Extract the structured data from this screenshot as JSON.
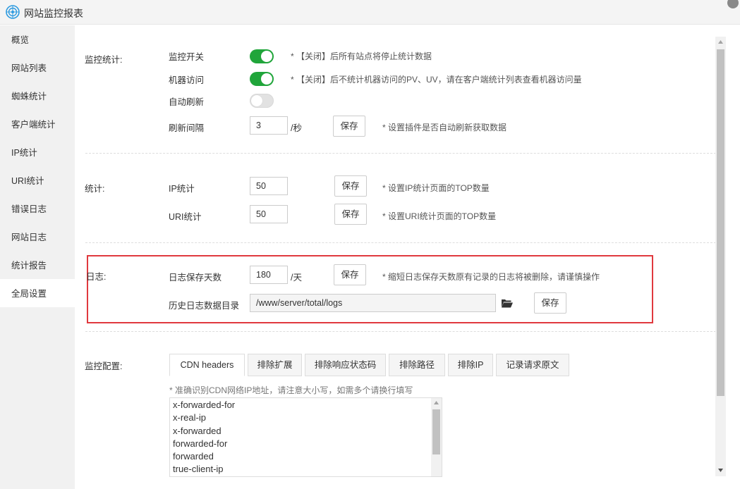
{
  "window": {
    "title": "网站监控报表"
  },
  "sidebar": {
    "items": [
      {
        "label": "概览"
      },
      {
        "label": "网站列表"
      },
      {
        "label": "蜘蛛统计"
      },
      {
        "label": "客户端统计"
      },
      {
        "label": "IP统计"
      },
      {
        "label": "URI统计"
      },
      {
        "label": "错误日志"
      },
      {
        "label": "网站日志"
      },
      {
        "label": "统计报告"
      },
      {
        "label": "全局设置"
      }
    ],
    "active_index": 9
  },
  "monitor": {
    "section_label": "监控统计:",
    "switch_label": "监控开关",
    "switch_on": true,
    "switch_hint": "* 【关闭】后所有站点将停止统计数据",
    "robot_label": "机器访问",
    "robot_on": true,
    "robot_hint": "* 【关闭】后不统计机器访问的PV、UV，请在客户端统计列表查看机器访问量",
    "autorefresh_label": "自动刷新",
    "autorefresh_on": false,
    "interval_label": "刷新间隔",
    "interval_value": "3",
    "interval_unit": "/秒",
    "save_label": "保存",
    "interval_hint": "* 设置插件是否自动刷新获取数据"
  },
  "stats": {
    "section_label": "统计:",
    "ip_label": "IP统计",
    "ip_value": "50",
    "ip_save": "保存",
    "ip_hint": "* 设置IP统计页面的TOP数量",
    "uri_label": "URI统计",
    "uri_value": "50",
    "uri_save": "保存",
    "uri_hint": "* 设置URI统计页面的TOP数量"
  },
  "logs": {
    "section_label": "日志:",
    "keep_label": "日志保存天数",
    "keep_value": "180",
    "keep_unit": "/天",
    "keep_save": "保存",
    "keep_hint": "* 缩短日志保存天数原有记录的日志将被删除，请谨慎操作",
    "dir_label": "历史日志数据目录",
    "dir_value": "/www/server/total/logs",
    "dir_save": "保存",
    "folder_icon": "folder-open-icon"
  },
  "config": {
    "section_label": "监控配置:",
    "tabs": [
      {
        "label": "CDN headers"
      },
      {
        "label": "排除扩展"
      },
      {
        "label": "排除响应状态码"
      },
      {
        "label": "排除路径"
      },
      {
        "label": "排除IP"
      },
      {
        "label": "记录请求原文"
      }
    ],
    "active_tab": 0,
    "cdn_hint": "* 准确识别CDN网络IP地址，请注意大小写，如需多个请换行填写",
    "cdn_headers": [
      "x-forwarded-for",
      "x-real-ip",
      "x-forwarded",
      "forwarded-for",
      "forwarded",
      "true-client-ip"
    ]
  },
  "colors": {
    "toggle_on": "#20a53a",
    "highlight_border": "#e0393e"
  }
}
